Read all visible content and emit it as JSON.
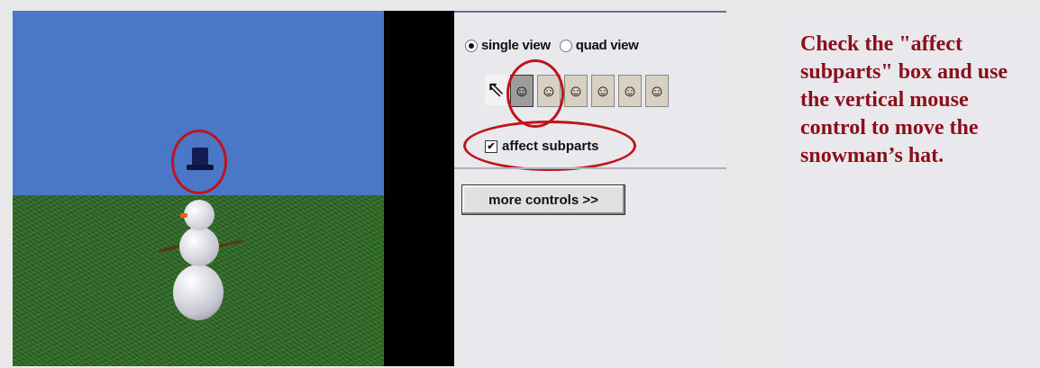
{
  "view_options": {
    "single_view_label": "single view",
    "quad_view_label": "quad view",
    "selected": "single view"
  },
  "toolbar": {
    "tools": [
      "pointer-icon",
      "vertical-move-icon",
      "move-icon",
      "rotate-icon",
      "turn-icon",
      "resize-icon",
      "drop-icon"
    ],
    "selected_tool": "vertical-move-icon"
  },
  "affect_subparts": {
    "label": "affect subparts",
    "checked": true
  },
  "more_controls": {
    "label": "more controls  >>"
  },
  "instruction": {
    "text": "Check the \"affect subparts\" box and use the vertical mouse control to move the snowman’s hat."
  },
  "colors": {
    "sky": "#4a78c6",
    "grass": "#2f6b25",
    "highlight_circle": "#c0141c",
    "instruction_text": "#8b0f1a"
  }
}
